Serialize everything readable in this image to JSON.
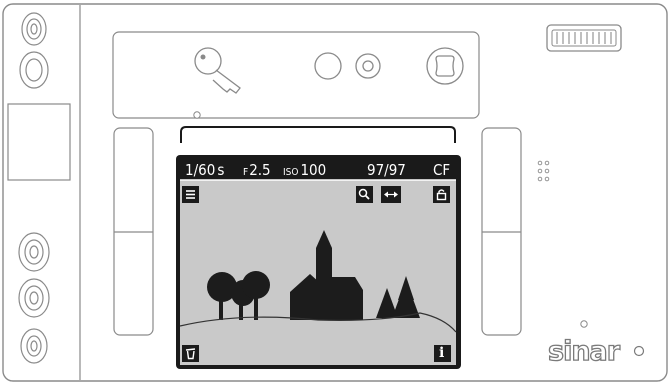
{
  "status_bar": {
    "shutter": "1/60",
    "shutter_unit": "s",
    "aperture_prefix": "F",
    "aperture": "2.5",
    "iso_label": "ISO",
    "iso": "100",
    "shots": "97/97",
    "storage": "CF"
  },
  "icons": {
    "menu": "menu-icon",
    "zoom": "magnify-icon",
    "move": "pan-arrows-icon",
    "protect": "lock-icon",
    "delete": "trash-icon",
    "info": "info-icon",
    "info_glyph": "i"
  },
  "brand": {
    "logo": "sinar"
  },
  "colors": {
    "body_outline": "#8a8a8a",
    "lcd_bezel": "#1a1a1a",
    "lcd_screen": "#c9c9c9",
    "silhouette": "#1c1c1c"
  }
}
